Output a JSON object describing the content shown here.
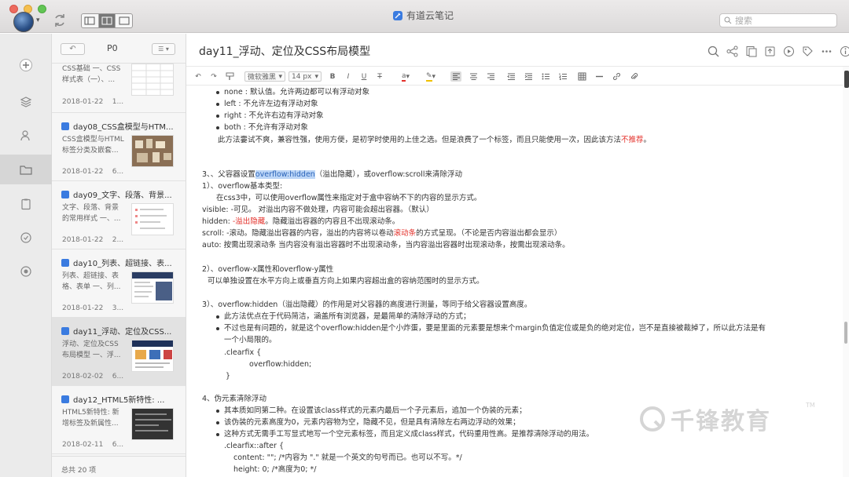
{
  "app": {
    "title": "有道云笔记",
    "search_placeholder": "搜索"
  },
  "notelist": {
    "folder": "P0",
    "footer": "总共 20 项",
    "notes": [
      {
        "title": "",
        "snippet": "CSS基础 一、CSS样式表（一）、...",
        "date": "2018-01-22",
        "size": "1..."
      },
      {
        "title": "day08_CSS盒模型与HTM...",
        "snippet": "CSS盒模型与HTML标签分类及嵌套...",
        "date": "2018-01-22",
        "size": "6..."
      },
      {
        "title": "day09_文字、段落、背景...",
        "snippet": "文字、段落、背景的常用样式 一、...",
        "date": "2018-01-22",
        "size": "2..."
      },
      {
        "title": "day10_列表、超链接、表...",
        "snippet": "列表、超链接、表格、表单 一、列...",
        "date": "2018-01-22",
        "size": "3..."
      },
      {
        "title": "day11_浮动、定位及CSS...",
        "snippet": "浮动、定位及CSS布局模型 一、浮...",
        "date": "2018-02-02",
        "size": "6..."
      },
      {
        "title": "day12_HTML5新特性: ...",
        "snippet": "HTML5新特性: 新增标签及新属性...",
        "date": "2018-02-11",
        "size": "6..."
      }
    ]
  },
  "editor": {
    "title": "day11_浮动、定位及CSS布局模型",
    "font": "微软雅黑",
    "size": "14 px"
  },
  "content": {
    "l1": "none : 默认值。允许两边都可以有浮动对象",
    "l2": "left : 不允许左边有浮动对象",
    "l3": "right : 不允许右边有浮动对象",
    "l4": "both : 不允许有浮动对象",
    "l5a": "此方法嫑试不爽，兼容性强，使用方便，是初学时使用的上佳之选。但是浪费了一个标签，而且只能使用一次，因此该方法",
    "l5b": "不推荐",
    "l5c": "。",
    "h3a": "3、、父容器设置",
    "h3b": "overflow:hidden",
    "h3c": "（溢出隐藏），或overflow:scroll来清除浮动",
    "s1": "1）、overflow基本类型:",
    "s2": "在css3中，可以使用overflow属性来指定对于盒中容纳不下的内容的显示方式。",
    "s3": "visible: -可见。 对溢出内容不做处理，内容可能会超出容器。（默认）",
    "s4a": "hidden: ",
    "s4b": "-溢出隐藏",
    "s4c": "。隐藏溢出容器的内容且不出现滚动条。",
    "s5a": "scroll: -滚动。隐藏溢出容器的内容，溢出的内容将以卷动",
    "s5b": "滚动条",
    "s5c": "的方式呈现。（不论是否内容溢出都会显示）",
    "s6": "auto: 按需出现滚动条 当内容没有溢出容器时不出现滚动条，当内容溢出容器时出现滚动条，按需出现滚动条。",
    "t1": "2）、overflow-x属性和overflow-y属性",
    "t2": "可以单独设置在水平方向上或垂直方向上如果内容超出盒的容纳范围时的显示方式。",
    "u1": "3）、overflow:hidden（溢出隐藏）的作用是对父容器的高度进行测量，等同于给父容器设置高度。",
    "u2": "此方法优点在于代码简洁，涵盖所有浏览器，是最简单的清除浮动的方式；",
    "u3": "不过也是有问题的，就是这个overflow:hidden是个小炸蛋，要是里面的元素要是想来个margin负值定位或是负的绝对定位，岂不是直接被裁掉了，所以此方法是有",
    "u4": "一个小局限的。",
    "u5": ".clearfix {",
    "u6": "overflow:hidden;",
    "u7": "}",
    "v1": "4、伪元素清除浮动",
    "v2": "其本质如同第二种。在设置该class样式的元素内最后一个子元素后，追加一个伪装的元素；",
    "v3": "该伪装的元素高度为0，元素内容物为空，隐藏不见，但是具有清除左右两边浮动的效果；",
    "v4": "这种方式无需手工写显式地写一个空元素标签，而且定义成class样式，代码重用性高。是推荐清除浮动的用法。",
    "v5": ".clearfix::after {",
    "v6": "content: \"\"; /*内容为 \".\" 就是一个英文的句号而已。也可以不写。*/",
    "v7": "height: 0; /*高度为0; */"
  },
  "watermark": {
    "text": "千锋教育",
    "tm": "TM"
  },
  "colors": {
    "accent": "#3a7be0",
    "red": "#e3302a"
  }
}
